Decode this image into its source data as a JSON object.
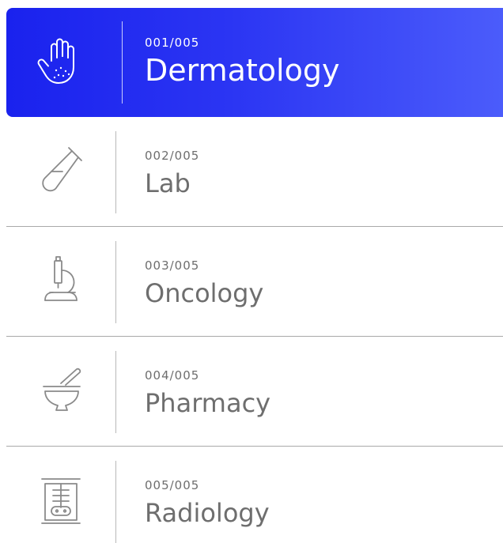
{
  "colors": {
    "active_start": "#1a22ee",
    "active_end": "#4b5cfb",
    "text_inactive": "#6e6e6e",
    "text_active": "#ffffff",
    "divider": "#a9a9a9"
  },
  "items": [
    {
      "number": "001/005",
      "label": "Dermatology",
      "icon": "hand-icon",
      "active": true
    },
    {
      "number": "002/005",
      "label": "Lab",
      "icon": "test-tube-icon",
      "active": false
    },
    {
      "number": "003/005",
      "label": "Oncology",
      "icon": "microscope-icon",
      "active": false
    },
    {
      "number": "004/005",
      "label": "Pharmacy",
      "icon": "mortar-pestle-icon",
      "active": false
    },
    {
      "number": "005/005",
      "label": "Radiology",
      "icon": "xray-icon",
      "active": false
    }
  ]
}
